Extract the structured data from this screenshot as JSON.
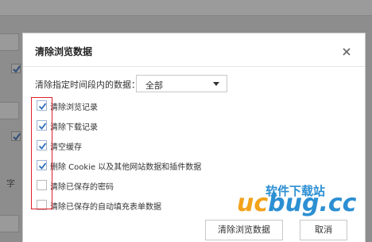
{
  "background": {
    "side_label": "字"
  },
  "dialog": {
    "title": "清除浏览数据",
    "range_label": "清除指定时间段内的数据：",
    "range_selected": "全部",
    "options": [
      {
        "label": "清除浏览记录",
        "checked": true
      },
      {
        "label": "清除下载记录",
        "checked": true
      },
      {
        "label": "清空缓存",
        "checked": true
      },
      {
        "label": "删除 Cookie 以及其他网站数据和插件数据",
        "checked": true
      },
      {
        "label": "清除已保存的密码",
        "checked": false
      },
      {
        "label": "清除已保存的自动填充表单数据",
        "checked": false
      }
    ],
    "clear_button": "清除浏览数据",
    "cancel_button": "取消"
  },
  "watermark": {
    "top_text": "软件下载站",
    "brand_prefix": "uc",
    "brand_rest": "bug.cc"
  },
  "colors": {
    "highlight_box": "#e0202a",
    "checkbox_check": "#2b6cb8",
    "watermark_blue": "#2c8fd3",
    "watermark_orange": "#f2a21b"
  }
}
